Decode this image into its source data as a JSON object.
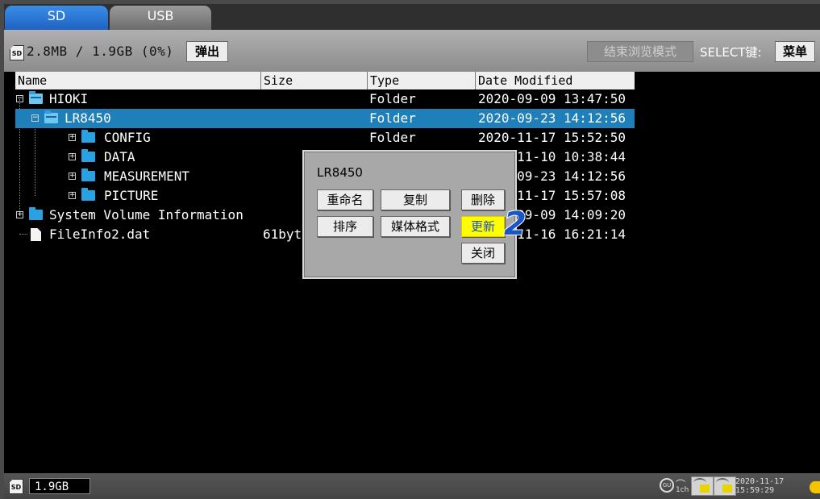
{
  "tabs": [
    {
      "label": "SD",
      "active": true
    },
    {
      "label": "USB",
      "active": false
    }
  ],
  "toolbar": {
    "sd_icon_text": "SD",
    "usage": "2.8MB / 1.9GB (0%)",
    "eject_label": "弹出",
    "end_browse_label": "结束浏览模式",
    "select_key_label": "SELECT键:",
    "menu_label": "菜单"
  },
  "columns": {
    "name": "Name",
    "size": "Size",
    "type": "Type",
    "date": "Date Modified"
  },
  "rows": [
    {
      "name": "HIOKI",
      "size": "",
      "type": "Folder",
      "date": "2020-09-09 13:47:50",
      "icon": "folder-open-icon"
    },
    {
      "name": "LR8450",
      "size": "",
      "type": "Folder",
      "date": "2020-09-23 14:12:56",
      "icon": "folder-open-icon",
      "selected": true
    },
    {
      "name": "CONFIG",
      "size": "",
      "type": "Folder",
      "date": "2020-11-17 15:52:50",
      "icon": "folder-icon"
    },
    {
      "name": "DATA",
      "size": "",
      "type": "Folder",
      "date": "2020-11-10 10:38:44",
      "icon": "folder-icon"
    },
    {
      "name": "MEASUREMENT",
      "size": "",
      "type": "Folder",
      "date": "2020-09-23 14:12:56",
      "icon": "folder-icon"
    },
    {
      "name": "PICTURE",
      "size": "",
      "type": "Folder",
      "date": "2020-11-17 15:57:08",
      "icon": "folder-icon"
    },
    {
      "name": "System Volume Information",
      "size": "",
      "type": "Folder",
      "date": "2020-09-09 14:09:20",
      "icon": "folder-icon"
    },
    {
      "name": "FileInfo2.dat",
      "size": "61bytes",
      "type": "",
      "date": "2020-11-16 16:21:14",
      "icon": "file-icon"
    }
  ],
  "popup": {
    "title": "LR8450",
    "rename": "重命名",
    "copy": "复制",
    "delete": "删除",
    "sort": "排序",
    "format": "媒体格式",
    "update": "更新",
    "close": "关闭"
  },
  "step_badge": "2",
  "status": {
    "sd_icon_text": "SD",
    "capacity": "1.9GB",
    "channel_icon_text": "GU",
    "channel_text": "1ch",
    "clock_date": "2020-11-17",
    "clock_time": "15:59:29"
  },
  "colors": {
    "selected_row": "#1f7fb8",
    "focused_button": "#ffff00",
    "tab_active": "#2b78d8",
    "step_badge": "#1a55c8"
  }
}
